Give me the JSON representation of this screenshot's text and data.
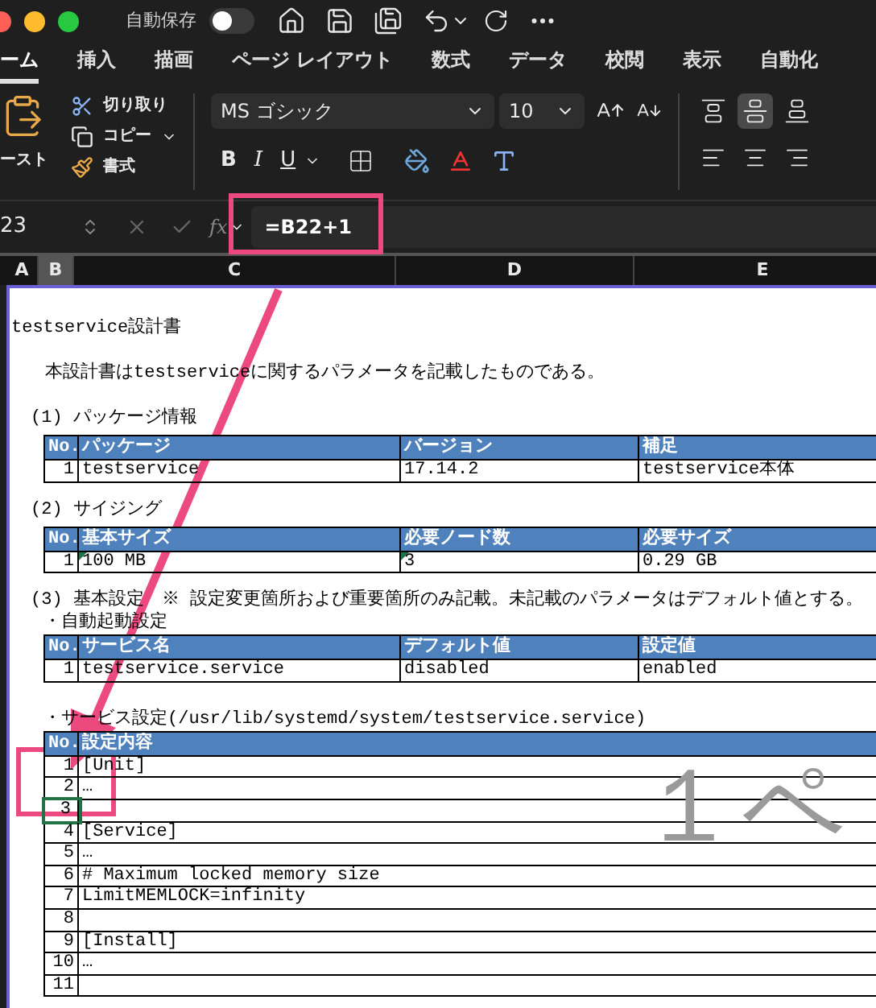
{
  "window": {
    "autosave_label": "自動保存",
    "autosave_on": false
  },
  "tabs": [
    {
      "label": "ーム",
      "selected": true
    },
    {
      "label": "挿入",
      "selected": false
    },
    {
      "label": "描画",
      "selected": false
    },
    {
      "label": "ページ レイアウト",
      "selected": false
    },
    {
      "label": "数式",
      "selected": false
    },
    {
      "label": "データ",
      "selected": false
    },
    {
      "label": "校閲",
      "selected": false
    },
    {
      "label": "表示",
      "selected": false
    },
    {
      "label": "自動化",
      "selected": false
    }
  ],
  "ribbon": {
    "paste": "ースト",
    "cut": "切り取り",
    "copy": "コピー",
    "format": "書式",
    "font_name": "MS ゴシック",
    "font_size": "10",
    "style_buttons": [
      "B",
      "I",
      "U"
    ],
    "vertical_align": [
      {
        "selected": false
      },
      {
        "selected": true
      },
      {
        "selected": false
      }
    ]
  },
  "formula_bar": {
    "cell": "23",
    "fx": "fx",
    "formula": "=B22+1"
  },
  "columns": [
    {
      "label": "A",
      "selected": false
    },
    {
      "label": "B",
      "selected": true
    },
    {
      "label": "C",
      "selected": false
    },
    {
      "label": "D",
      "selected": false
    },
    {
      "label": "E",
      "selected": false
    }
  ],
  "blocks": [
    {
      "kind": "title",
      "text": "testservice設計書"
    },
    {
      "kind": "description",
      "text": "本設計書はtestserviceに関するパラメータを記載したものである。"
    },
    {
      "kind": "heading",
      "text": "(1)  パッケージ情報"
    },
    {
      "kind": "table",
      "columns": [
        "No.",
        "パッケージ",
        "バージョン",
        "補足"
      ],
      "rows": [
        {
          "cells": [
            "1",
            "testservice",
            "17.14.2",
            "testservice本体"
          ],
          "selected": false
        }
      ]
    },
    {
      "kind": "heading",
      "text": "(2)  サイジング"
    },
    {
      "kind": "table",
      "columns": [
        "No.",
        "基本サイズ",
        "必要ノード数",
        "必要サイズ"
      ],
      "rows": [
        {
          "cells": [
            "1",
            "100 MB",
            "3",
            "0.29 GB"
          ],
          "selected": false,
          "markers": [
            false,
            true,
            true,
            false
          ]
        }
      ]
    },
    {
      "kind": "heading",
      "text": "(3)  基本設定　※ 設定変更箇所および重要箇所のみ記載。未記載のパラメータはデフォルト値とする。"
    },
    {
      "kind": "subheading",
      "text": "・自動起動設定"
    },
    {
      "kind": "table",
      "columns": [
        "No.",
        "サービス名",
        "デフォルト値",
        "設定値"
      ],
      "rows": [
        {
          "cells": [
            "1",
            "testservice.service",
            "disabled",
            "enabled"
          ],
          "selected": false
        }
      ]
    },
    {
      "kind": "subheading",
      "text": "・サービス設定(/usr/lib/systemd/system/testservice.service)"
    },
    {
      "kind": "table",
      "columns": [
        "No.",
        "設定内容"
      ],
      "rows": [
        {
          "cells": [
            "1",
            "[Unit]"
          ],
          "selected": false
        },
        {
          "cells": [
            "2",
            "…"
          ],
          "selected": false
        },
        {
          "cells": [
            "3",
            ""
          ],
          "selected": true
        },
        {
          "cells": [
            "4",
            "[Service]"
          ],
          "selected": false
        },
        {
          "cells": [
            "5",
            "…"
          ],
          "selected": false
        },
        {
          "cells": [
            "6",
            "# Maximum locked memory size"
          ],
          "selected": false
        },
        {
          "cells": [
            "7",
            "LimitMEMLOCK=infinity"
          ],
          "selected": false
        },
        {
          "cells": [
            "8",
            ""
          ],
          "selected": false
        },
        {
          "cells": [
            "9",
            "[Install]"
          ],
          "selected": false
        },
        {
          "cells": [
            "10",
            "…"
          ],
          "selected": false
        },
        {
          "cells": [
            "11",
            ""
          ],
          "selected": false
        }
      ]
    }
  ],
  "page_label": "１ペ"
}
